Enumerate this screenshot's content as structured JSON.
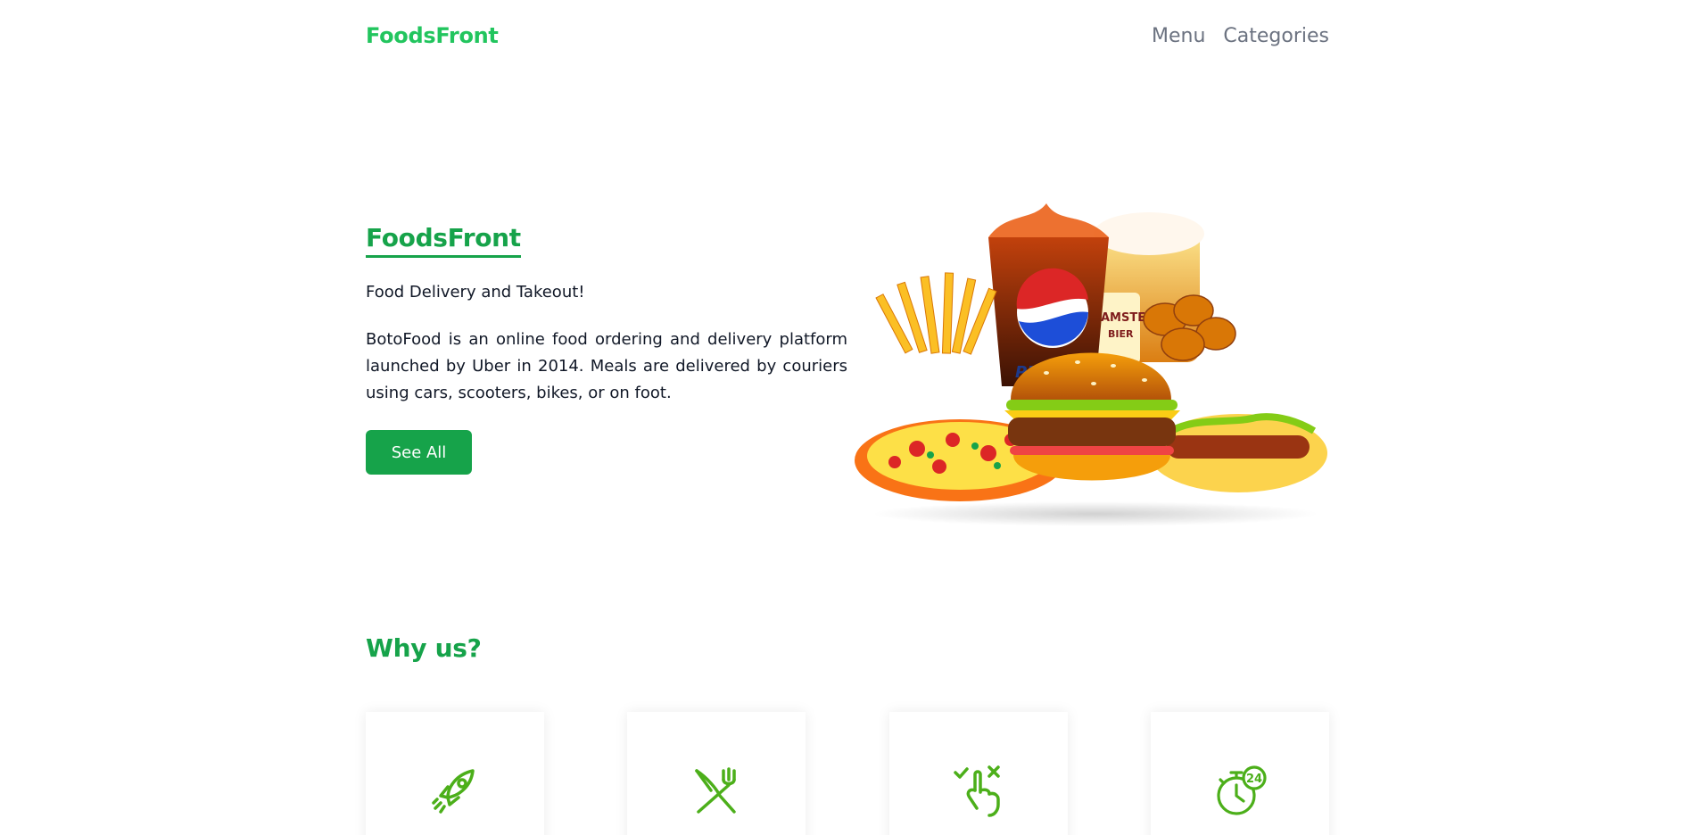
{
  "nav": {
    "brand": "FoodsFront",
    "links": [
      "Menu",
      "Categories"
    ]
  },
  "hero": {
    "title": "FoodsFront",
    "subtitle": "Food Delivery and Takeout!",
    "description": "BotoFood is an online food ordering and delivery platform launched by Uber in 2014. Meals are delivered by couriers using cars, scooters, bikes, or on foot.",
    "button_label": "See All",
    "image": "food-combo-illustration",
    "image_text": [
      "PEPSI",
      "AMSTEL",
      "BIER"
    ]
  },
  "why": {
    "title": "Why us?",
    "features": [
      {
        "icon": "rocket-icon"
      },
      {
        "icon": "fork-knife-icon"
      },
      {
        "icon": "tap-choice-icon"
      },
      {
        "icon": "clock-24-icon",
        "badge": "24"
      }
    ]
  },
  "colors": {
    "brand": "#22c55e",
    "accent": "#16a34a",
    "icon": "#4caf1a",
    "nav_link": "#6b7280"
  }
}
